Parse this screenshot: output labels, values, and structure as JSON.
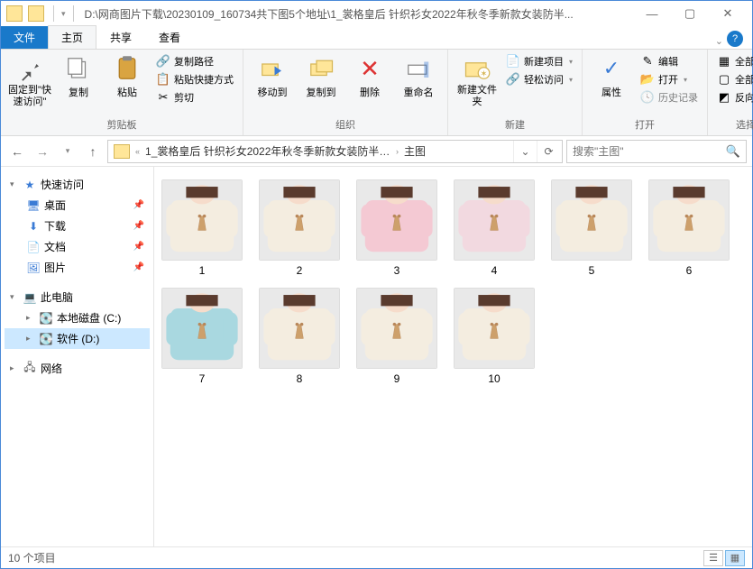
{
  "title_path": "D:\\网商图片下载\\20230109_160734共下图5个地址\\1_裳格皇后 针织衫女2022年秋冬季新款女装防半...",
  "tabs": {
    "file": "文件",
    "home": "主页",
    "share": "共享",
    "view": "查看"
  },
  "ribbon": {
    "pin": "固定到\"快速访问\"",
    "copy": "复制",
    "paste": "粘贴",
    "copy_path": "复制路径",
    "paste_shortcut": "粘贴快捷方式",
    "cut": "剪切",
    "clipboard": "剪贴板",
    "move_to": "移动到",
    "copy_to": "复制到",
    "delete": "删除",
    "rename": "重命名",
    "organize": "组织",
    "new_folder": "新建文件夹",
    "new_item": "新建项目",
    "easy_access": "轻松访问",
    "new": "新建",
    "properties": "属性",
    "open_btn": "打开",
    "edit": "编辑",
    "history": "历史记录",
    "open": "打开",
    "select_all": "全部选择",
    "select_none": "全部取消",
    "invert_sel": "反向选择",
    "select": "选择"
  },
  "breadcrumb": {
    "item1": "1_裳格皇后 针织衫女2022年秋冬季新款女装防半高领...",
    "item2": "主图"
  },
  "search_placeholder": "搜索\"主图\"",
  "sidebar": {
    "quick_access": "快速访问",
    "desktop": "桌面",
    "downloads": "下载",
    "documents": "文档",
    "pictures": "图片",
    "this_pc": "此电脑",
    "drive_c": "本地磁盘 (C:)",
    "drive_d": "软件 (D:)",
    "network": "网络"
  },
  "thumbs": [
    "1",
    "2",
    "3",
    "4",
    "5",
    "6",
    "7",
    "8",
    "9",
    "10"
  ],
  "thumb_colors": [
    "#f4ede0",
    "#f4ede0",
    "#f4c9d3",
    "#f2d9e0",
    "#f4ede0",
    "#f4ede0",
    "#a9d8e0",
    "#f4ede0",
    "#f4ede0",
    "#f4ede0"
  ],
  "status_text": "10 个项目"
}
